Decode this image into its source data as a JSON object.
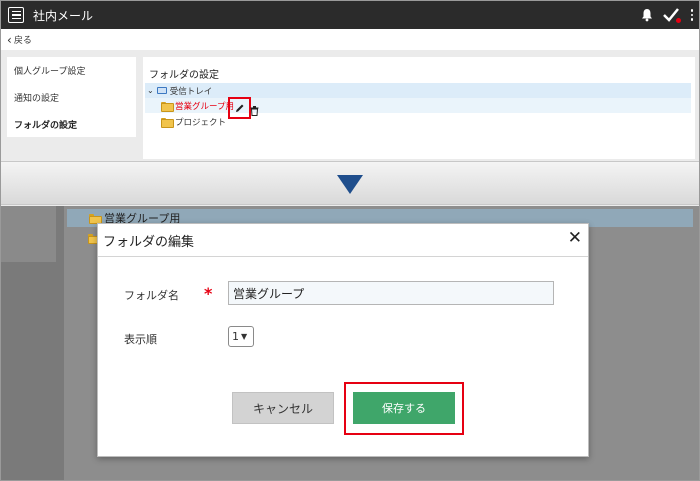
{
  "app": {
    "title": "社内メール"
  },
  "nav": {
    "back_label": "戻る"
  },
  "sidebar": {
    "items": [
      {
        "label": "個人グループ設定"
      },
      {
        "label": "通知の設定"
      },
      {
        "label": "フォルダの設定"
      }
    ]
  },
  "folder_panel": {
    "title": "フォルダの設定",
    "tree": [
      {
        "label": "受信トレイ",
        "icon": "inbox-icon"
      },
      {
        "label": "営業グループ用",
        "icon": "folder-icon",
        "color": "#e60012"
      },
      {
        "label": "プロジェクト",
        "icon": "folder-icon"
      }
    ]
  },
  "background": {
    "selected_folder": "営業グループ用"
  },
  "modal": {
    "title": "フォルダの編集",
    "name_label": "フォルダ名",
    "required_mark": "*",
    "name_value": "営業グループ",
    "order_label": "表示順",
    "order_value": "1",
    "cancel_label": "キャンセル",
    "save_label": "保存する"
  },
  "colors": {
    "accent_red": "#e60012",
    "save_green": "#3fa66a",
    "arrow_blue": "#1f4e8c",
    "titlebar": "#2b2b2b"
  }
}
